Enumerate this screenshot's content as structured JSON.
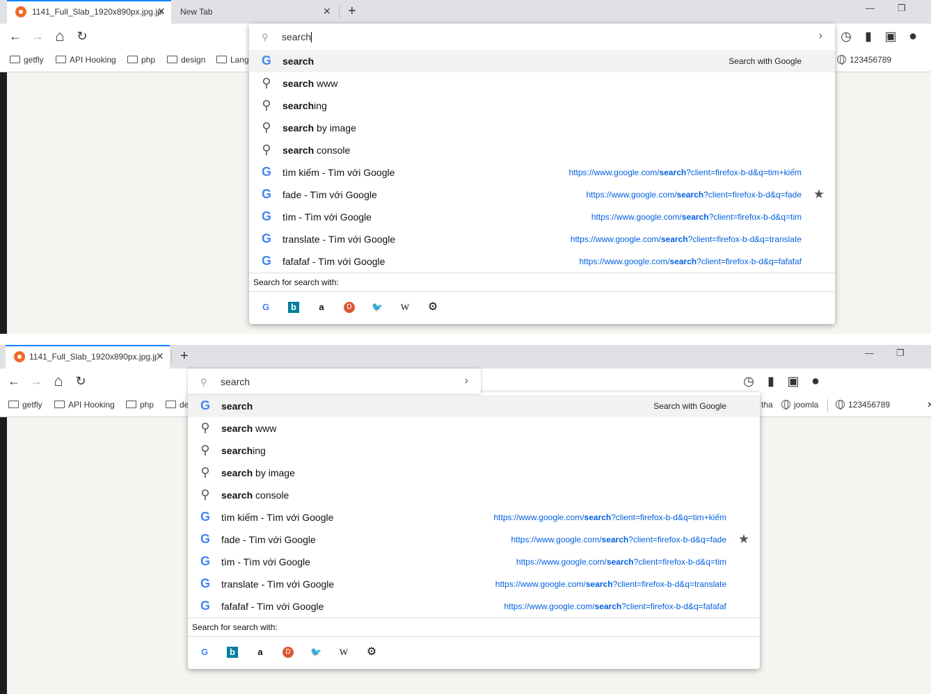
{
  "tabs": {
    "tab1_title": "1141_Full_Slab_1920x890px.jpg.jpg",
    "tab2_title": "New Tab"
  },
  "bookmarks": {
    "getfly": "getfly",
    "api": "API Hooking",
    "php": "php",
    "design": "design",
    "lang": "Lang",
    "lang2": "de",
    "tha": "tha",
    "joomla": "joomla",
    "num": "123456789"
  },
  "search": {
    "query": "search",
    "search_with": "Search with Google",
    "search_for_label": "Search for search with:"
  },
  "suggestions": [
    {
      "bold": "search",
      "rest": ""
    },
    {
      "bold": "search",
      "rest": " www"
    },
    {
      "bold": "search",
      "rest": "ing"
    },
    {
      "bold": "search",
      "rest": " by image"
    },
    {
      "bold": "search",
      "rest": " console"
    }
  ],
  "history": [
    {
      "title": "tìm kiếm - Tìm với Google",
      "url_pre": "https://www.google.com/",
      "url_bold": "search",
      "url_post": "?client=firefox-b-d&q=tim+kiếm"
    },
    {
      "title": "fade - Tìm với Google",
      "url_pre": "https://www.google.com/",
      "url_bold": "search",
      "url_post": "?client=firefox-b-d&q=fade"
    },
    {
      "title": "tìm - Tìm với Google",
      "url_pre": "https://www.google.com/",
      "url_bold": "search",
      "url_post": "?client=firefox-b-d&q=tim"
    },
    {
      "title": "translate - Tìm với Google",
      "url_pre": "https://www.google.com/",
      "url_bold": "search",
      "url_post": "?client=firefox-b-d&q=translate"
    },
    {
      "title": "fafafaf - Tìm với Google",
      "url_pre": "https://www.google.com/",
      "url_bold": "search",
      "url_post": "?client=firefox-b-d&q=fafafaf"
    }
  ],
  "icons": {
    "back": "←",
    "forward": "→",
    "home": "⌂",
    "reload": "↻",
    "close": "✕",
    "plus": "+",
    "minimize": "—",
    "restore": "❐",
    "history": "◷",
    "bookmarks": "▮",
    "library": "▣",
    "account": "●",
    "magnifier": "⚲",
    "chevron": "›",
    "star": "★",
    "gear": "⚙",
    "google": "G",
    "bing": "b",
    "amazon": "a",
    "ddg": "D",
    "twitter": "🐦",
    "wikipedia": "W"
  }
}
